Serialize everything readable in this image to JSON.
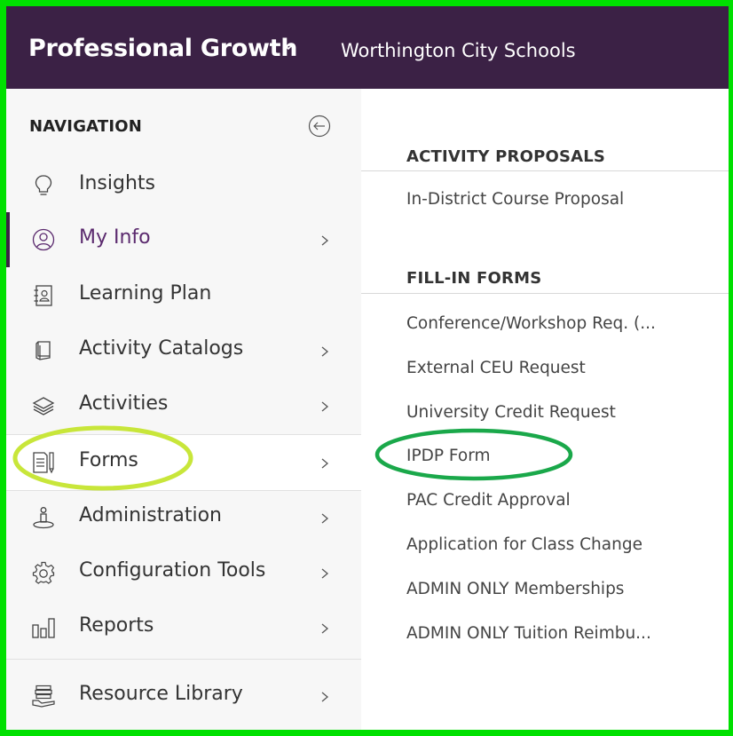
{
  "header": {
    "app_title": "Professional Growth",
    "org_name": "Worthington City Schools"
  },
  "sidebar": {
    "heading": "NAVIGATION",
    "items": [
      {
        "label": "Insights",
        "icon": "lightbulb-icon",
        "has_chevron": false
      },
      {
        "label": "My Info",
        "icon": "user-circle-icon",
        "has_chevron": true,
        "active": true
      },
      {
        "label": "Learning Plan",
        "icon": "contact-book-icon",
        "has_chevron": false
      },
      {
        "label": "Activity Catalogs",
        "icon": "book-icon",
        "has_chevron": true
      },
      {
        "label": "Activities",
        "icon": "layers-icon",
        "has_chevron": true
      },
      {
        "label": "Forms",
        "icon": "form-pencil-icon",
        "has_chevron": true,
        "highlighted": true
      },
      {
        "label": "Administration",
        "icon": "admin-person-icon",
        "has_chevron": true
      },
      {
        "label": "Configuration Tools",
        "icon": "gear-icon",
        "has_chevron": true
      },
      {
        "label": "Reports",
        "icon": "bar-chart-icon",
        "has_chevron": true
      },
      {
        "label": "Resource Library",
        "icon": "library-books-icon",
        "has_chevron": true
      }
    ]
  },
  "submenu": {
    "sections": [
      {
        "title": "ACTIVITY PROPOSALS",
        "links": [
          "In-District Course Proposal"
        ]
      },
      {
        "title": "FILL-IN FORMS",
        "links": [
          "Conference/Workshop Req. (...",
          "External CEU Request",
          "University Credit Request",
          "IPDP Form",
          "PAC Credit Approval",
          "Application for Class Change",
          "ADMIN ONLY Memberships",
          "ADMIN ONLY Tuition Reimbu..."
        ]
      }
    ]
  },
  "colors": {
    "header_bg": "#3b2145",
    "frame_border": "#00e000",
    "active_text": "#5b2a6e",
    "annotation_forms": "#c8e63a",
    "annotation_ipdp": "#1aa84a"
  }
}
